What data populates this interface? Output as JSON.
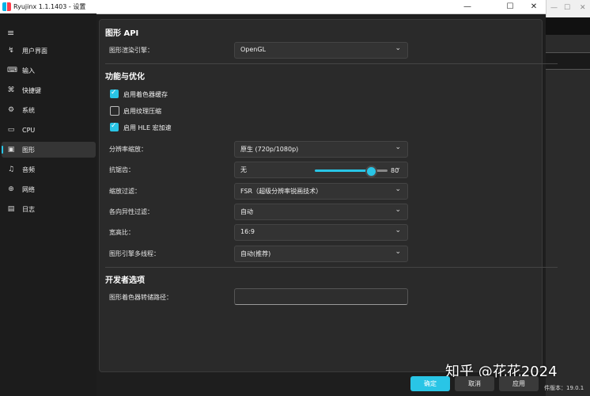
{
  "window": {
    "title": "Ryujinx 1.1.1403 - 设置",
    "minimize_glyph": "—",
    "maximize_glyph": "☐",
    "close_glyph": "✕"
  },
  "bg_window": {
    "minimize_glyph": "—",
    "maximize_glyph": "☐",
    "close_glyph": "✕"
  },
  "sidebar": {
    "menu_glyph": "≡",
    "items": [
      {
        "label": "用户界面",
        "icon": "ui-icon",
        "glyph": "↯"
      },
      {
        "label": "输入",
        "icon": "gamepad-icon",
        "glyph": "⌨"
      },
      {
        "label": "快捷键",
        "icon": "keyboard-icon",
        "glyph": "⌘"
      },
      {
        "label": "系统",
        "icon": "gear-icon",
        "glyph": "⚙"
      },
      {
        "label": "CPU",
        "icon": "cpu-icon",
        "glyph": "▭"
      },
      {
        "label": "图形",
        "icon": "image-icon",
        "glyph": "▣"
      },
      {
        "label": "音频",
        "icon": "music-icon",
        "glyph": "♫"
      },
      {
        "label": "网络",
        "icon": "globe-icon",
        "glyph": "⊕"
      },
      {
        "label": "日志",
        "icon": "document-icon",
        "glyph": "▤"
      }
    ],
    "selected": "图形"
  },
  "graphics_api": {
    "heading": "图形 API",
    "backend_label": "图形渲染引擎：",
    "backend_value": "OpenGL"
  },
  "enhancements": {
    "heading": "功能与优化",
    "checkboxes": [
      {
        "label": "启用着色器缓存",
        "checked": true
      },
      {
        "label": "启用纹理压缩",
        "checked": false
      },
      {
        "label": "启用 HLE 宏加速",
        "checked": true
      }
    ],
    "resolution_label": "分辨率缩放：",
    "resolution_value": "原生 (720p/1080p)",
    "aa_label": "抗锯齿：",
    "aa_value": "无",
    "scaling_filter_label": "缩放过滤：",
    "scaling_filter_value": "FSR（超级分辨率锐画技术）",
    "scaling_filter_level": 80,
    "aniso_label": "各向异性过滤：",
    "aniso_value": "自动",
    "aspect_label": "宽高比：",
    "aspect_value": "16:9",
    "multithread_label": "图形引擎多线程：",
    "multithread_value": "自动(推荐)"
  },
  "developer": {
    "heading": "开发者选项",
    "shader_dump_label": "图形着色器转储路径：",
    "shader_dump_value": ""
  },
  "buttons": {
    "ok": "确定",
    "cancel": "取消",
    "apply": "应用"
  },
  "footer": {
    "version_fragment": "件版本：19.0.1"
  },
  "watermark": "知乎 @花花2024",
  "colors": {
    "accent": "#29c5e6",
    "panel": "#2a2a2a",
    "sidebar": "#1c1c1c"
  }
}
